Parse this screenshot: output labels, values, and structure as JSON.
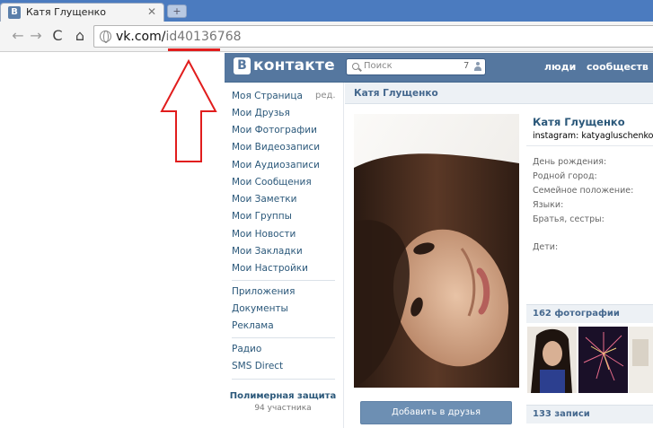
{
  "browser": {
    "tab": {
      "favicon_letter": "B",
      "title": "Катя Глущенко",
      "close_glyph": "✕"
    },
    "new_tab_glyph": "+",
    "nav": {
      "back": "←",
      "forward": "→",
      "reload": "C",
      "home": "⌂"
    },
    "address": {
      "host": "vk.com/",
      "path": "id40136768"
    }
  },
  "annotation": {
    "color": "#e11d1d"
  },
  "vk": {
    "colors": {
      "header": "#55779f",
      "link": "#2b587a",
      "accent": "#45688e",
      "bar": "#edf1f5",
      "button": "#6d8fb3"
    },
    "logo_letter": "B",
    "logo_text": "контакте",
    "search": {
      "placeholder": "Поиск",
      "count": "7"
    },
    "nav": [
      "люди",
      "сообществ"
    ],
    "menu": {
      "items": [
        "Моя Страница",
        "Мои Друзья",
        "Мои Фотографии",
        "Мои Видеозаписи",
        "Мои Аудиозаписи",
        "Мои Сообщения",
        "Мои Заметки",
        "Мои Группы",
        "Мои Новости",
        "Мои Закладки",
        "Мои Настройки"
      ],
      "edit_label": "ред.",
      "items_2": [
        "Приложения",
        "Документы",
        "Реклама"
      ],
      "items_3": [
        "Радио",
        "SMS Direct"
      ],
      "promo": {
        "title": "Полимерная защита",
        "subtitle": "94 участника"
      }
    },
    "content": {
      "title": "Катя Глущенко",
      "name": "Катя Глущенко",
      "status": "instagram: katyagluschenko",
      "info_labels": [
        "День рождения:",
        "Родной город:",
        "Семейное положение:",
        "Языки:",
        "Братья, сестры:",
        "Дети:"
      ],
      "photos_header": "162 фотографии",
      "posts_header": "133 записи",
      "add_friend_label": "Добавить в друзья"
    }
  }
}
